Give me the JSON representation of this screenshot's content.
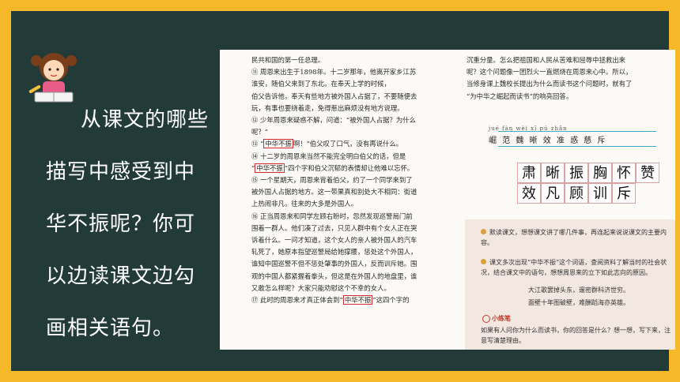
{
  "prompt": {
    "text": "从课文的哪些描写中感受到中华不振呢？你可以边读课文边勾画相关语句。"
  },
  "textbook": {
    "left_paragraphs": [
      "民共和国的第一任总理。",
      "⑪ 周恩来出生于1898年。十二岁那年，他离开家乡江苏",
      "淮安，随伯父来到了东北。在奉天上学的时候，",
      "伯父告诉他，奉天有些地方被外国人占据了，不要随便去",
      "玩，有事也要绕着走，免得惹出麻烦没有地方说理。",
      "⑫ 少年周恩来疑惑不解，问道：“被外国人占据？为什么",
      "呢？”",
      "⑬ “中华不振啊！”伯父叹了口气，没有再说什么。",
      "⑭ 十二岁的周恩来当然不能完全明白伯父的话，但是",
      "“中华不振”四个字和伯父沉郁的表情却让他难以忘怀。",
      "⑮ 一个星期天，周恩来背着伯父，约了一个同学来到了",
      "被外国人占据的地方。这一带果真和别处大不相同：街道",
      "上热闹非凡，往来的大多是外国人。",
      "⑯ 正当周恩来和同学左顾右盼时，忽然发现巡警局门前",
      "围着一群人。他们凑了过去，只见人群中有个女人正在哭",
      "诉着什么。一问才知道，这个女人的亲人被外国人的汽车",
      "轧死了，她原本指望巡警局给她撑腰，惩处这个外国人，",
      "谁知中国巡警不但不惩处肇事的外国人，反而训斥她。围",
      "观的中国人都紧握着拳头，但这是在外国人的地盘里，谁",
      "又敢怎么样呢？大家只能劝慰这个不幸的女人。",
      "⑰ 此时的周恩来才真正体会到“中华不振”这四个字的"
    ],
    "right_paragraphs": [
      "沉重分量。怎么把祖国和人民从苦难和屈辱中拯救出来",
      "呢？这个问题像一团烈火一直燃烧在周恩来心中。所以，",
      "当修身课上魏校长提出为什么而读书这个问题时，就有了",
      "“为中华之崛起而读书”的响亮回答。"
    ],
    "pinyin": "jué fàn wèi xī pú zhǎn",
    "vocab_chars": "崛 范 魏 晰 效 准 惑 慈 斥",
    "grid_chars": [
      "肃",
      "晰",
      "振",
      "胸",
      "怀",
      "赞",
      "效",
      "凡",
      "顾",
      "训",
      "斥",
      ""
    ],
    "exercises": [
      "默读课文，想想课文讲了哪几件事，再连起来说说课文的主要内容。",
      "课文多次出现“中华不振”这个词语，查阅资料了解当时的社会状况，结合课文中的语句，想想周恩来的立下如此志向的原因。"
    ],
    "poem": [
      "大江歌罢掉头东，邃密群科济世穷。",
      "面壁十年图破壁，难酬蹈海亦英雄。"
    ],
    "practice_label": "小练笔",
    "practice_text": "如果有人问你为什么而读书，你的回答是什么？想一想，写下来，注意写清楚理由。"
  }
}
